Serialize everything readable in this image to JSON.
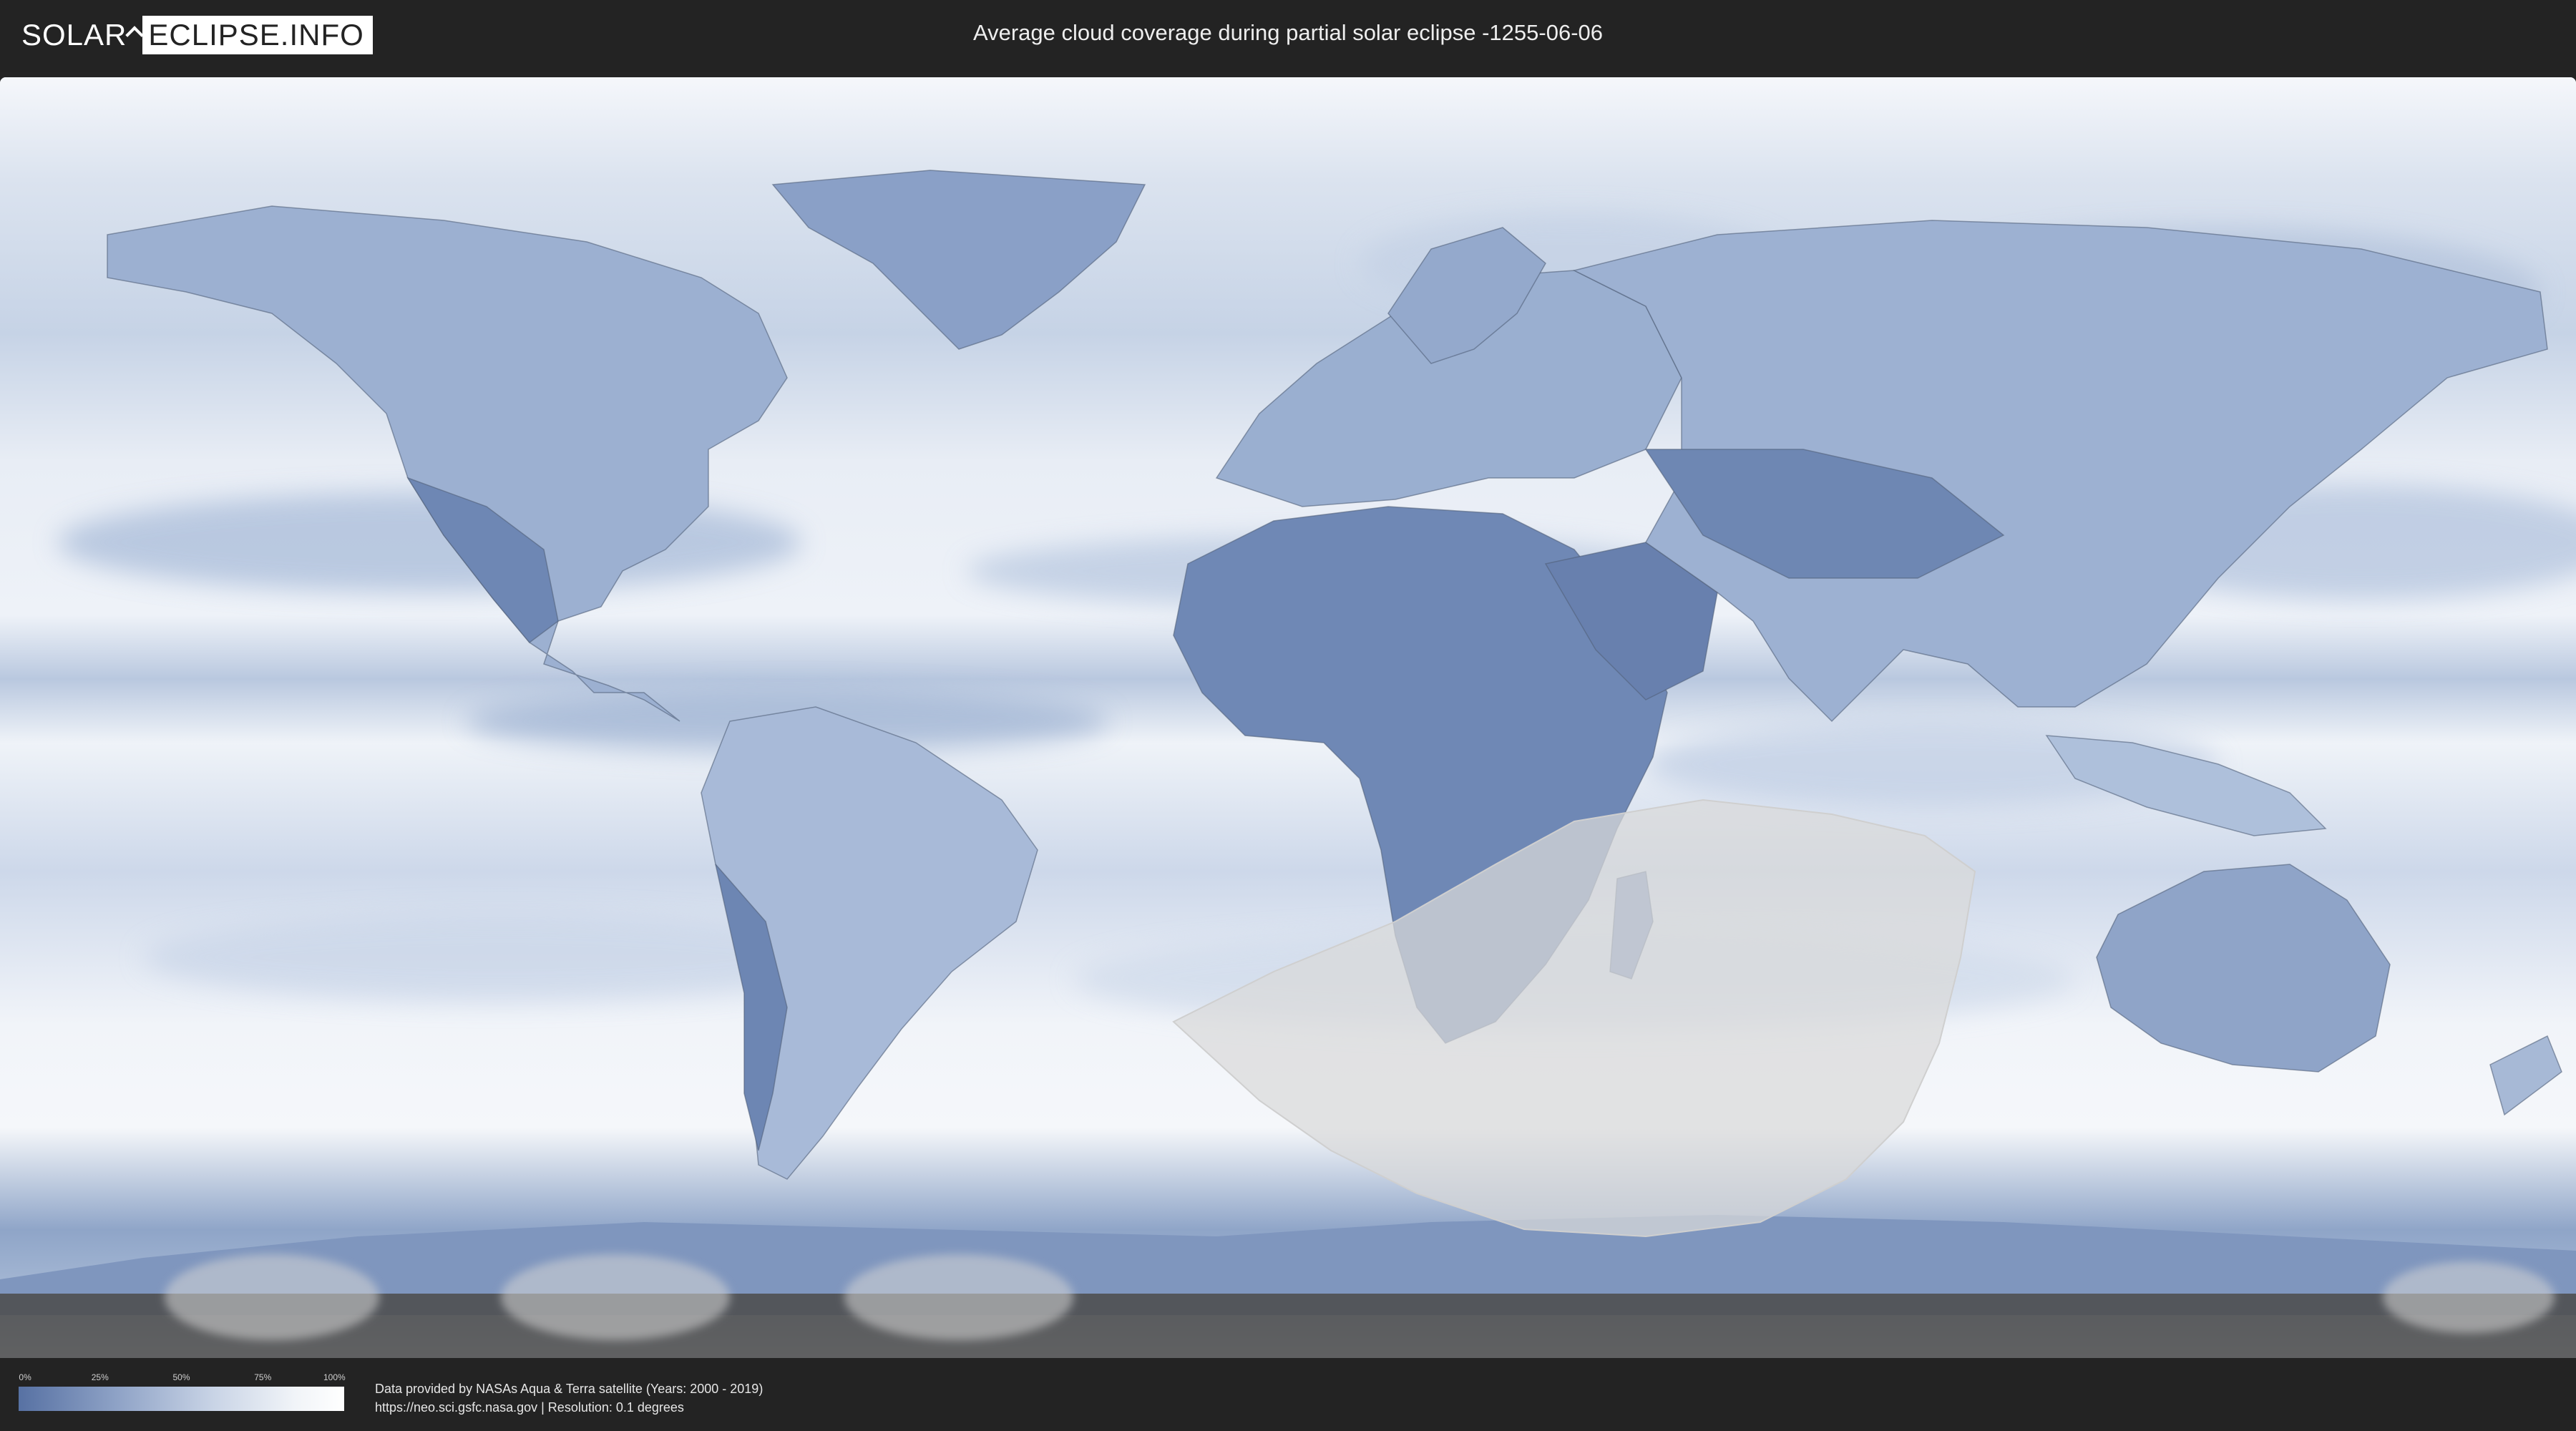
{
  "header": {
    "logo_text_left": "SOLAR",
    "logo_text_right": "ECLIPSE.INFO",
    "title": "Average cloud coverage during partial solar eclipse -1255-06-06"
  },
  "legend": {
    "ticks": [
      "0%",
      "25%",
      "50%",
      "75%",
      "100%"
    ],
    "tick_values": [
      0,
      25,
      50,
      75,
      100
    ],
    "color_low": "#5771a3",
    "color_high": "#ffffff"
  },
  "footer": {
    "credit_line1": "Data provided by NASAs Aqua & Terra satellite (Years: 2000 - 2019)",
    "credit_line2": "https://neo.sci.gsfc.nasa.gov | Resolution: 0.1 degrees"
  },
  "colors": {
    "background": "#232323",
    "land_dark": "#5d79aa",
    "cloud_clear": "#f4f6fa",
    "eclipse_zone": "#d9d9d9"
  }
}
